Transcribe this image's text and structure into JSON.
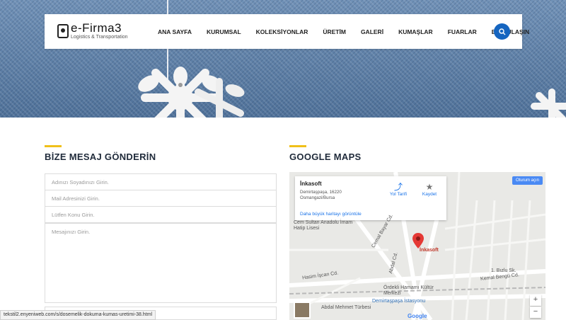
{
  "header": {
    "logo_title": "e-Firma3",
    "logo_subtitle": "Logistics & Transportation",
    "menu": [
      {
        "label": "ANA SAYFA"
      },
      {
        "label": "KURUMSAL"
      },
      {
        "label": "KOLEKSİYONLAR"
      },
      {
        "label": "ÜRETİM"
      },
      {
        "label": "GALERİ"
      },
      {
        "label": "KUMAŞLAR"
      },
      {
        "label": "FUARLAR"
      },
      {
        "label": "BİZE ULAŞIN"
      }
    ],
    "search_icon": "search-icon"
  },
  "contact": {
    "title": "BİZE MESAJ GÖNDERİN",
    "name_placeholder": "Adınızı Soyadınızı Girin.",
    "email_placeholder": "Mail Adresinizi Girin.",
    "subject_placeholder": "Lütfen Konu Girin.",
    "message_placeholder": "Mesajınızı Girin."
  },
  "maps": {
    "title": "GOOGLE MAPS",
    "place_name": "İnkasoft",
    "address": "Demirtaşpaşa, 16220 Osmangazi/Bursa",
    "directions_label": "Yol Tarifi",
    "save_label": "Kaydet",
    "larger_map_link": "Daha büyük haritayı görüntüle",
    "signin_label": "Oturum açın",
    "pin_label": "İnkasoft",
    "zoom_in": "+",
    "zoom_out": "−",
    "google": "Google",
    "labels": {
      "school": "Cem Sultan Anadolu İmam Hatip Lisesi",
      "hamam": "Ördekli Hamamı Kültür Merkezi",
      "station": "Demirtaşpaşa İstasyonu",
      "tomb": "Abdal Mehmet Türbesi",
      "street1": "Hasim İşcan Cd.",
      "street2": "Kemal Bengü Cd.",
      "street3": "1. Bızlu Sk.",
      "street4": "Cemal Bayar Cd.",
      "street5": "Abdal Cd."
    }
  },
  "status_bar": {
    "url": "tekstil2.enyeniweb.com/s/dosemelik-dokuma-kumas-uretimi-38.html"
  },
  "colors": {
    "accent": "#f0c01a",
    "primary": "#1565c0",
    "pin": "#e53935"
  }
}
